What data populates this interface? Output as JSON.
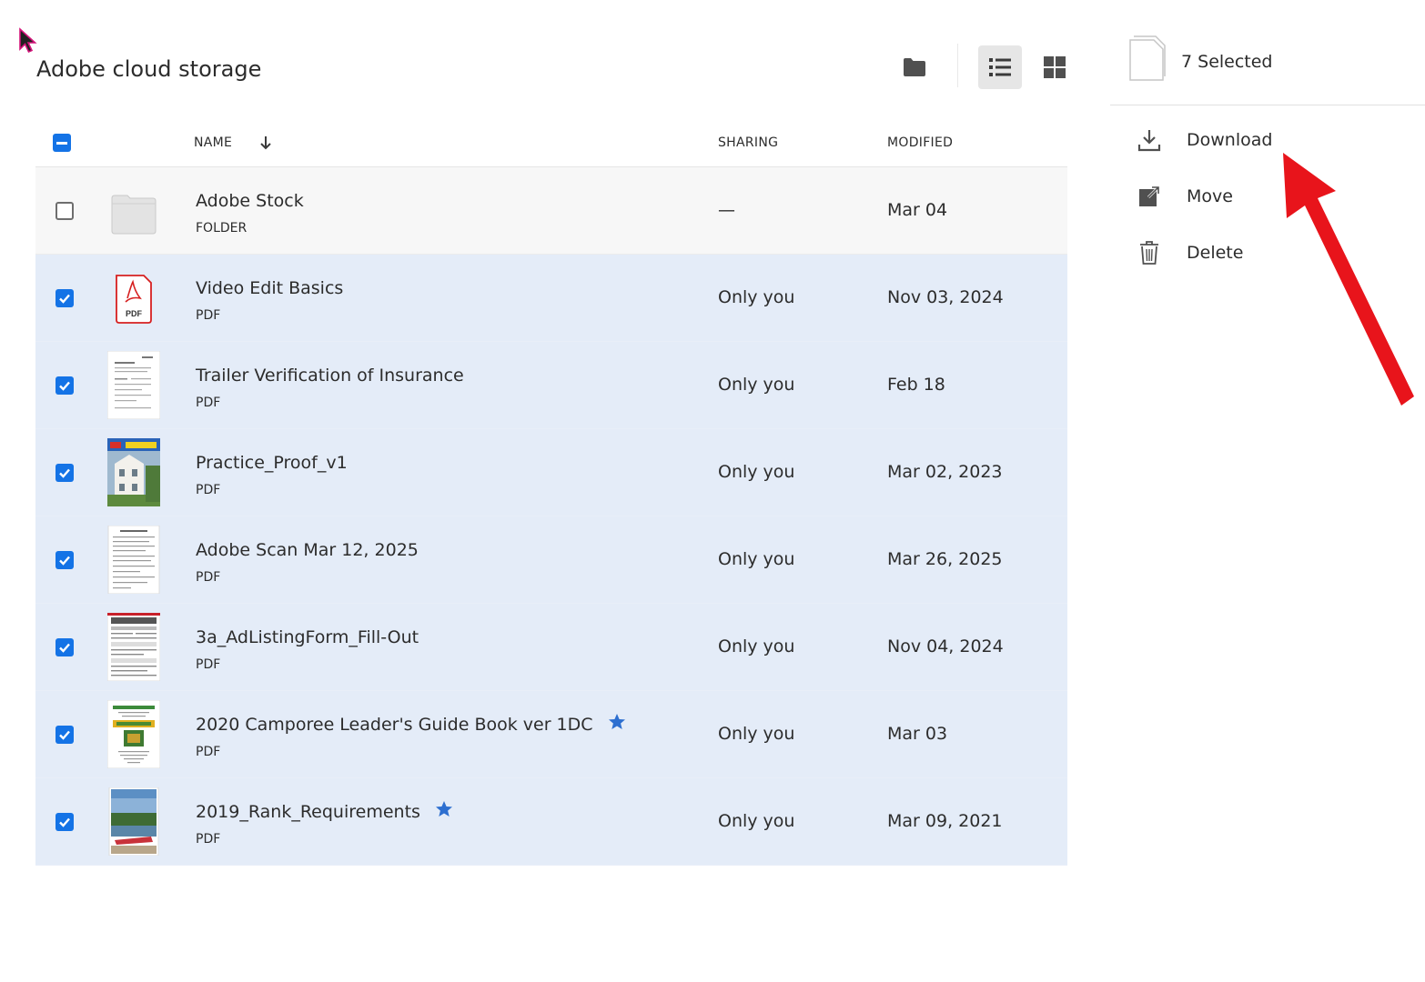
{
  "page": {
    "title": "Adobe cloud storage"
  },
  "toolbar": {
    "folder_icon": "folder-icon",
    "list_view_icon": "list-view-icon",
    "grid_view_icon": "grid-view-icon"
  },
  "table": {
    "columns": {
      "name": "NAME",
      "sharing": "SHARING",
      "modified": "MODIFIED"
    },
    "rows": [
      {
        "name": "Adobe Stock",
        "kind": "FOLDER",
        "sharing": "—",
        "modified": "Mar 04",
        "selected": false,
        "starred": false,
        "thumb": "folder"
      },
      {
        "name": "Video Edit Basics",
        "kind": "PDF",
        "sharing": "Only you",
        "modified": "Nov 03, 2024",
        "selected": true,
        "starred": false,
        "thumb": "pdf-icon"
      },
      {
        "name": "Trailer Verification of Insurance",
        "kind": "PDF",
        "sharing": "Only you",
        "modified": "Feb 18",
        "selected": true,
        "starred": false,
        "thumb": "document"
      },
      {
        "name": "Practice_Proof_v1",
        "kind": "PDF",
        "sharing": "Only you",
        "modified": "Mar 02, 2023",
        "selected": true,
        "starred": false,
        "thumb": "photo"
      },
      {
        "name": "Adobe Scan Mar 12, 2025",
        "kind": "PDF",
        "sharing": "Only you",
        "modified": "Mar 26, 2025",
        "selected": true,
        "starred": false,
        "thumb": "document"
      },
      {
        "name": "3a_AdListingForm_Fill-Out",
        "kind": "PDF",
        "sharing": "Only you",
        "modified": "Nov 04, 2024",
        "selected": true,
        "starred": false,
        "thumb": "form"
      },
      {
        "name": "2020 Camporee Leader's Guide Book ver 1DC",
        "kind": "PDF",
        "sharing": "Only you",
        "modified": "Mar 03",
        "selected": true,
        "starred": true,
        "thumb": "booklet"
      },
      {
        "name": "2019_Rank_Requirements",
        "kind": "PDF",
        "sharing": "Only you",
        "modified": "Mar 09, 2021",
        "selected": true,
        "starred": true,
        "thumb": "landscape"
      }
    ]
  },
  "side_panel": {
    "selected_count": "7 Selected",
    "actions": [
      {
        "label": "Download",
        "icon": "download-icon"
      },
      {
        "label": "Move",
        "icon": "move-icon"
      },
      {
        "label": "Delete",
        "icon": "trash-icon"
      }
    ]
  },
  "colors": {
    "accent": "#1473e6",
    "selected_row": "#e4ecf8",
    "star": "#2d6fd0",
    "annotation_arrow": "#e8141b"
  }
}
